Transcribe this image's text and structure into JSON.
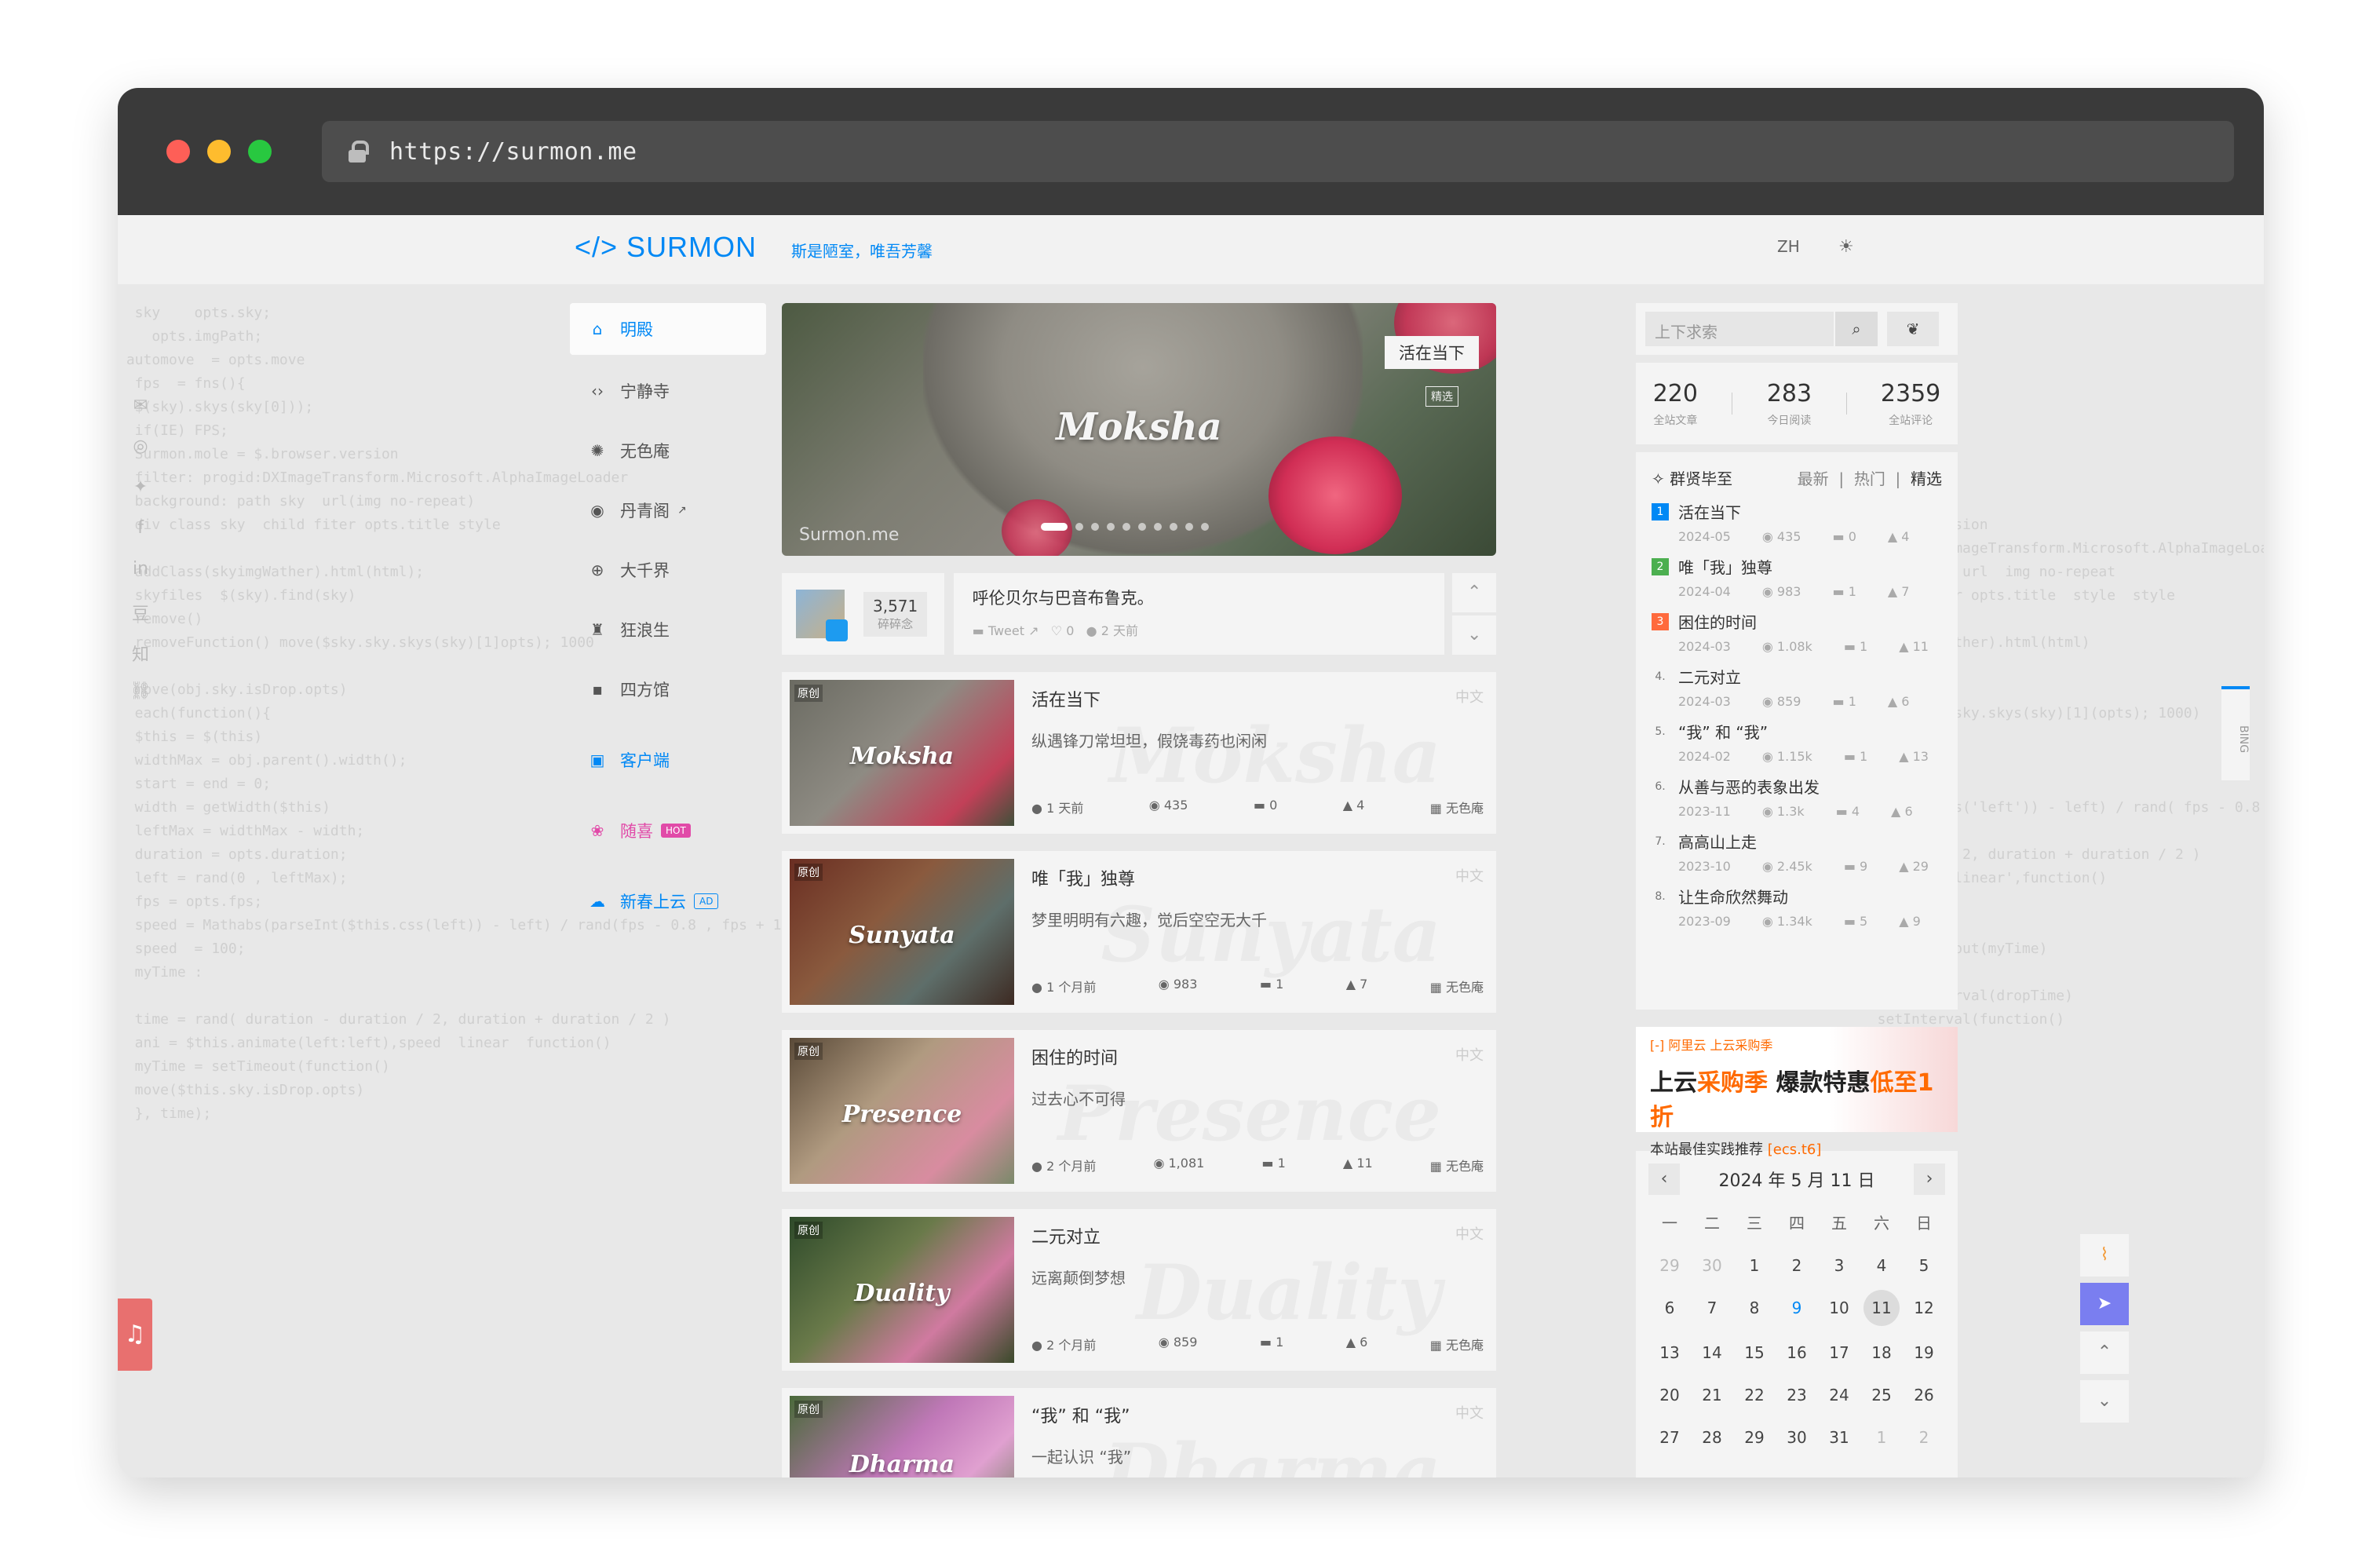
{
  "browser": {
    "url": "https://surmon.me",
    "dots": {
      "close": "#fe5f57",
      "minimize": "#febc2e",
      "maximize": "#28c840"
    }
  },
  "header": {
    "logo": "</> SURMON",
    "slogan": "斯是陋室，唯吾芳馨",
    "lang": "ZH",
    "theme_icon": "sun-icon"
  },
  "nav": [
    {
      "label": "明殿",
      "icon": "home-icon",
      "active": true
    },
    {
      "label": "宁静寺",
      "icon": "code-icon"
    },
    {
      "label": "无色庵",
      "icon": "lightbulb-icon"
    },
    {
      "label": "丹青阁",
      "icon": "github-icon"
    },
    {
      "label": "大千界",
      "icon": "globe-icon"
    },
    {
      "label": "狂浪生",
      "icon": "scroll-icon"
    },
    {
      "label": "四方馆",
      "icon": "chat-icon"
    },
    {
      "label": "客户端",
      "icon": "app-icon"
    },
    {
      "label": "随喜",
      "icon": "lotus-icon",
      "badge": "HOT"
    },
    {
      "label": "新春上云",
      "icon": "cloud-icon",
      "badge": "AD"
    }
  ],
  "hero": {
    "title": "Moksha",
    "tag": "活在当下",
    "pick": "精选",
    "brand": "Surmon.me"
  },
  "tweet": {
    "count": "3,571",
    "count_label": "碎碎念",
    "text": "呼伦贝尔与巴音布鲁克。",
    "source": "Tweet",
    "likes": "0",
    "time": "2 天前"
  },
  "posts": [
    {
      "title": "活在当下",
      "desc": "纵遇锋刀常坦坦，假饶毒药也闲闲",
      "word": "Moksha",
      "orig": "原创",
      "lang": "中文",
      "time": "1 天前",
      "views": "435",
      "comments": "0",
      "likes": "4",
      "cat": "无色庵"
    },
    {
      "title": "唯「我」独尊",
      "desc": "梦里明明有六趣，觉后空空无大千",
      "word": "Sunyata",
      "orig": "原创",
      "lang": "中文",
      "time": "1 个月前",
      "views": "983",
      "comments": "1",
      "likes": "7",
      "cat": "无色庵"
    },
    {
      "title": "困住的时间",
      "desc": "过去心不可得",
      "word": "Presence",
      "orig": "原创",
      "lang": "中文",
      "time": "2 个月前",
      "views": "1,081",
      "comments": "1",
      "likes": "11",
      "cat": "无色庵"
    },
    {
      "title": "二元对立",
      "desc": "远离颠倒梦想",
      "word": "Duality",
      "orig": "原创",
      "lang": "中文",
      "time": "2 个月前",
      "views": "859",
      "comments": "1",
      "likes": "6",
      "cat": "无色庵"
    },
    {
      "title": "“我” 和 “我”",
      "desc": "一起认识 “我”",
      "word": "Dharma",
      "orig": "原创",
      "lang": "中文"
    }
  ],
  "search": {
    "placeholder": "上下求索"
  },
  "stats": [
    {
      "value": "220",
      "label": "全站文章"
    },
    {
      "value": "283",
      "label": "今日阅读"
    },
    {
      "value": "2359",
      "label": "全站评论"
    }
  ],
  "toplist": {
    "title": "群贤毕至",
    "tabs": [
      "最新",
      "热门",
      "精选"
    ],
    "items": [
      {
        "rank": "1",
        "title": "活在当下",
        "date": "2024-05",
        "views": "435",
        "comments": "0",
        "likes": "4",
        "color": "#0088f5"
      },
      {
        "rank": "2",
        "title": "唯「我」独尊",
        "date": "2024-04",
        "views": "983",
        "comments": "1",
        "likes": "7",
        "color": "#4caf50"
      },
      {
        "rank": "3",
        "title": "困住的时间",
        "date": "2024-03",
        "views": "1.08k",
        "comments": "1",
        "likes": "11",
        "color": "#ff6a3d"
      },
      {
        "rank": "4.",
        "title": "二元对立",
        "date": "2024-03",
        "views": "859",
        "comments": "1",
        "likes": "6"
      },
      {
        "rank": "5.",
        "title": "“我” 和 “我”",
        "date": "2024-02",
        "views": "1.15k",
        "comments": "1",
        "likes": "13"
      },
      {
        "rank": "6.",
        "title": "从善与恶的表象出发",
        "date": "2023-11",
        "views": "1.3k",
        "comments": "4",
        "likes": "6"
      },
      {
        "rank": "7.",
        "title": "高高山上走",
        "date": "2023-10",
        "views": "2.45k",
        "comments": "9",
        "likes": "29"
      },
      {
        "rank": "8.",
        "title": "让生命欣然舞动",
        "date": "2023-09",
        "views": "1.34k",
        "comments": "5",
        "likes": "9"
      }
    ]
  },
  "ad": {
    "label": "[-] 阿里云  上云采购季",
    "headline_a": "上云",
    "headline_b": "采购季",
    "headline_c": " 爆款特惠",
    "headline_d": "低至1折",
    "sub": "本站最佳实践推荐",
    "code": "[ecs.t6]"
  },
  "calendar": {
    "title": "2024 年 5 月 11 日",
    "weekdays": [
      "一",
      "二",
      "三",
      "四",
      "五",
      "六",
      "日"
    ],
    "days": [
      "29",
      "30",
      "1",
      "2",
      "3",
      "4",
      "5",
      "6",
      "7",
      "8",
      "9",
      "10",
      "11",
      "12",
      "13",
      "14",
      "15",
      "16",
      "17",
      "18",
      "19",
      "20",
      "21",
      "22",
      "23",
      "24",
      "25",
      "26",
      "27",
      "28",
      "29",
      "30",
      "31",
      "1",
      "2"
    ]
  },
  "side_tools": [
    "rss-icon",
    "paper-plane-icon",
    "chevron-up-icon",
    "chevron-down-icon"
  ],
  "bing_label": "BING"
}
